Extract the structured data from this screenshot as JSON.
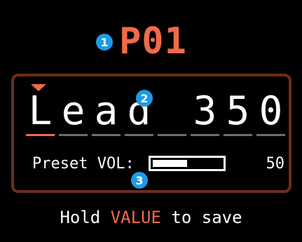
{
  "annotations": {
    "marker_1": "1",
    "marker_2": "2",
    "marker_3": "3"
  },
  "header": {
    "preset_id": "P01"
  },
  "preset_name": {
    "chars": [
      "L",
      "e",
      "a",
      "d",
      "",
      "3",
      "5",
      "0"
    ],
    "active_index": 0
  },
  "volume": {
    "label": "Preset VOL:",
    "value": "50",
    "level_fraction": 0.5
  },
  "footer": {
    "hint_before": "Hold ",
    "hint_key": "VALUE",
    "hint_after": " to save"
  },
  "colors": {
    "accent": "#f26a4b",
    "frame": "#6b2e1a",
    "badge": "#1e9be6",
    "inactive_underline": "#6e6e6e"
  }
}
